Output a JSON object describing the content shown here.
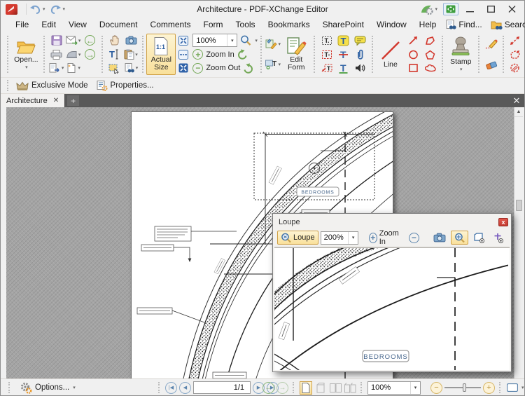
{
  "window": {
    "title": "Architecture - PDF-XChange Editor"
  },
  "menu": {
    "items": [
      "File",
      "Edit",
      "View",
      "Document",
      "Comments",
      "Form",
      "Tools",
      "Bookmarks",
      "SharePoint",
      "Window",
      "Help"
    ],
    "find_label": "Find...",
    "search_label": "Search..."
  },
  "toolbar": {
    "open_label": "Open...",
    "actual_size_label": "Actual Size",
    "zoom_value": "100%",
    "zoom_in_label": "Zoom In",
    "zoom_out_label": "Zoom Out",
    "edit_form_label": "Edit Form",
    "line_label": "Line",
    "stamp_label": "Stamp"
  },
  "ribbon": {
    "exclusive_mode_label": "Exclusive Mode",
    "properties_label": "Properties..."
  },
  "tabbar": {
    "active_tab": "Architecture"
  },
  "page": {
    "room_label": "BEDROOMS"
  },
  "loupe": {
    "title": "Loupe",
    "loupe_button_label": "Loupe",
    "zoom_value": "200%",
    "zoom_in_label": "Zoom In",
    "room_label": "BEDROOMS"
  },
  "statusbar": {
    "options_label": "Options...",
    "page_indicator": "1/1",
    "zoom_value": "100%"
  },
  "colors": {
    "selection_bg": "#f9e09a",
    "selection_border": "#cfa044",
    "tabbar_bg": "#595959",
    "canvas_bg": "#a4a4a4",
    "loupe_close_bg": "#cd4a41",
    "accent_green": "#74a857",
    "accent_blue": "#3a6ea5",
    "annotation_red": "#e03a2f"
  }
}
